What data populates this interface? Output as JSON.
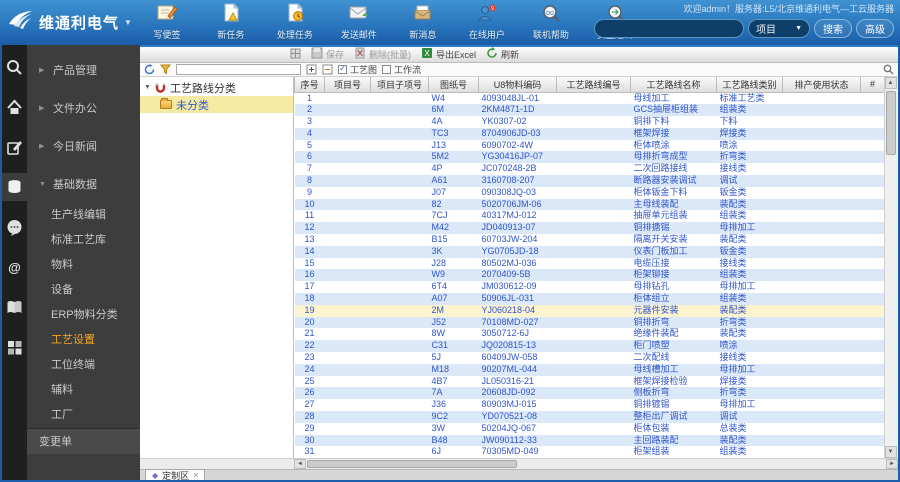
{
  "header": {
    "logo_text": "维通利电气",
    "welcome": "欢迎admin！服务器:L5/北京维通利电气—工云服务器",
    "toolbar": [
      {
        "icon": "note-edit",
        "label": "写便签"
      },
      {
        "icon": "doc-warning",
        "label": "新任务"
      },
      {
        "icon": "doc-clock",
        "label": "处理任务"
      },
      {
        "icon": "mail-send",
        "label": "发送邮件"
      },
      {
        "icon": "mail-new",
        "label": "新消息"
      },
      {
        "icon": "online-users",
        "label": "在线用户"
      },
      {
        "icon": "help-search",
        "label": "联机帮助"
      },
      {
        "icon": "logout",
        "label": "安全退出"
      }
    ],
    "search": {
      "value": "",
      "category": "项目",
      "search_btn": "搜索",
      "adv_btn": "高级"
    }
  },
  "rail": {
    "icons": [
      "search",
      "home",
      "edit",
      "database",
      "chat",
      "contact",
      "book",
      "gallery"
    ],
    "active": "database"
  },
  "sidebar": {
    "sections": [
      {
        "label": "产品管理",
        "expanded": false
      },
      {
        "label": "文件办公",
        "expanded": false
      },
      {
        "label": "今日新闻",
        "expanded": false
      },
      {
        "label": "基础数据",
        "expanded": true
      }
    ],
    "submenu": {
      "items": [
        "生产线编辑",
        "标准工艺库",
        "物料",
        "设备",
        "ERP物料分类",
        "工艺设置",
        "工位终端",
        "辅料",
        "工厂"
      ],
      "active_index": 5
    },
    "footer_item": "变更单"
  },
  "toolbar1": {
    "buttons": [
      {
        "label": "保存",
        "enabled": false
      },
      {
        "label": "删除(批量)",
        "enabled": false
      },
      {
        "label": "导出Excel",
        "enabled": true
      },
      {
        "label": "刷新",
        "enabled": true
      }
    ]
  },
  "toolbar2": {
    "filter_value": "",
    "checkbox1": {
      "label": "工艺图",
      "checked": true
    },
    "checkbox2": {
      "label": "工作流",
      "checked": false
    }
  },
  "tree": {
    "root": "工艺路线分类",
    "child": "未分类"
  },
  "table": {
    "columns": [
      "序号",
      "项目号",
      "项目子项号",
      "图纸号",
      "U8物料编码",
      "工艺路线编号",
      "工艺路线名称",
      "工艺路线类别",
      "排产使用状态",
      "#"
    ],
    "highlight_row": 19,
    "rows": [
      [
        "1",
        "",
        "",
        "W4",
        "4093048JL-01",
        "",
        "母线加工",
        "标准工艺类",
        "",
        ""
      ],
      [
        "2",
        "",
        "",
        "6M",
        "2KM4871-1D",
        "",
        "GCS抽屉柜组装",
        "组装类",
        "",
        ""
      ],
      [
        "3",
        "",
        "",
        "4A",
        "YK0307-02",
        "",
        "铜排下料",
        "下料",
        "",
        ""
      ],
      [
        "4",
        "",
        "",
        "TC3",
        "8704906JD-03",
        "",
        "框架焊接",
        "焊接类",
        "",
        ""
      ],
      [
        "5",
        "",
        "",
        "J13",
        "6090702-4W",
        "",
        "柜体喷涂",
        "喷涂",
        "",
        ""
      ],
      [
        "6",
        "",
        "",
        "5M2",
        "YG30416JP-07",
        "",
        "母排折弯成型",
        "折弯类",
        "",
        ""
      ],
      [
        "7",
        "",
        "",
        "4P",
        "JC070248-2B",
        "",
        "二次回路接线",
        "接线类",
        "",
        ""
      ],
      [
        "8",
        "",
        "",
        "A61",
        "3160708-207",
        "",
        "断路器安装调试",
        "调试",
        "",
        ""
      ],
      [
        "9",
        "",
        "",
        "J07",
        "090308JQ-03",
        "",
        "柜体钣金下料",
        "钣金类",
        "",
        ""
      ],
      [
        "10",
        "",
        "",
        "82",
        "5020706JM-06",
        "",
        "主母线装配",
        "装配类",
        "",
        ""
      ],
      [
        "11",
        "",
        "",
        "7CJ",
        "40317MJ-012",
        "",
        "抽屉单元组装",
        "组装类",
        "",
        ""
      ],
      [
        "12",
        "",
        "",
        "M42",
        "JD040913-07",
        "",
        "铜排搪锡",
        "母排加工",
        "",
        ""
      ],
      [
        "13",
        "",
        "",
        "B15",
        "60703JW-204",
        "",
        "隔离开关安装",
        "装配类",
        "",
        ""
      ],
      [
        "14",
        "",
        "",
        "3K",
        "YG0705JD-18",
        "",
        "仪表门板加工",
        "钣金类",
        "",
        ""
      ],
      [
        "15",
        "",
        "",
        "J28",
        "80502MJ-036",
        "",
        "电缆压接",
        "接线类",
        "",
        ""
      ],
      [
        "16",
        "",
        "",
        "W9",
        "2070409-5B",
        "",
        "柜架铆接",
        "组装类",
        "",
        ""
      ],
      [
        "17",
        "",
        "",
        "6T4",
        "JM030612-09",
        "",
        "母排钻孔",
        "母排加工",
        "",
        ""
      ],
      [
        "18",
        "",
        "",
        "A07",
        "50906JL-031",
        "",
        "柜体组立",
        "组装类",
        "",
        ""
      ],
      [
        "19",
        "",
        "",
        "2M",
        "YJ060218-04",
        "",
        "元器件安装",
        "装配类",
        "",
        ""
      ],
      [
        "20",
        "",
        "",
        "J52",
        "70108MD-027",
        "",
        "铜排折弯",
        "折弯类",
        "",
        ""
      ],
      [
        "21",
        "",
        "",
        "8W",
        "3050712-6J",
        "",
        "绝缘件装配",
        "装配类",
        "",
        ""
      ],
      [
        "22",
        "",
        "",
        "C31",
        "JQ020815-13",
        "",
        "柜门喷塑",
        "喷涂",
        "",
        ""
      ],
      [
        "23",
        "",
        "",
        "5J",
        "60409JW-058",
        "",
        "二次配线",
        "接线类",
        "",
        ""
      ],
      [
        "24",
        "",
        "",
        "M18",
        "90207ML-044",
        "",
        "母线槽加工",
        "母排加工",
        "",
        ""
      ],
      [
        "25",
        "",
        "",
        "4B7",
        "JL050316-21",
        "",
        "框架焊接检验",
        "焊接类",
        "",
        ""
      ],
      [
        "26",
        "",
        "",
        "7A",
        "20608JD-092",
        "",
        "侧板折弯",
        "折弯类",
        "",
        ""
      ],
      [
        "27",
        "",
        "",
        "J36",
        "80903MJ-015",
        "",
        "铜排镀锡",
        "母排加工",
        "",
        ""
      ],
      [
        "28",
        "",
        "",
        "9C2",
        "YD070521-08",
        "",
        "整柜出厂调试",
        "调试",
        "",
        ""
      ],
      [
        "29",
        "",
        "",
        "3W",
        "50204JQ-067",
        "",
        "柜体包装",
        "总装类",
        "",
        ""
      ],
      [
        "30",
        "",
        "",
        "B48",
        "JW090112-33",
        "",
        "主回路装配",
        "装配类",
        "",
        ""
      ],
      [
        "31",
        "",
        "",
        "6J",
        "70305MD-049",
        "",
        "柜架组装",
        "组装类",
        "",
        ""
      ]
    ]
  },
  "footer": {
    "tab": "定制区"
  },
  "colors": {
    "header_blue": "#2a77bd",
    "accent_orange": "#f5a623",
    "row_alt": "#dbe8f8",
    "row_highlight": "#fcf3cf",
    "link_blue": "#2f55cc"
  }
}
